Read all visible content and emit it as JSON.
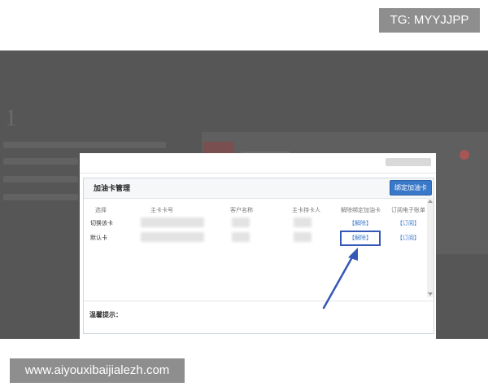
{
  "watermark": {
    "tg": "TG: MYYJJPP",
    "site": "www.aiyouxibaijialezh.com"
  },
  "background": {
    "step_number": "1"
  },
  "dialog": {
    "panel_title": "加油卡管理",
    "bind_button": "绑定加油卡",
    "columns": [
      "选择",
      "主卡卡号",
      "客户名称",
      "主卡持卡人",
      "解除绑定加油卡",
      "订阅电子账单"
    ],
    "rows": [
      {
        "select": "切换该卡",
        "unbind": "【解除】",
        "subscribe": "【订阅】"
      },
      {
        "select": "默认卡",
        "unbind": "【解除】",
        "subscribe": "【订阅】"
      }
    ],
    "tips_label": "温馨提示："
  },
  "colors": {
    "overlay": "#565656",
    "accent": "#3a78c9",
    "highlight": "#3557b6"
  }
}
